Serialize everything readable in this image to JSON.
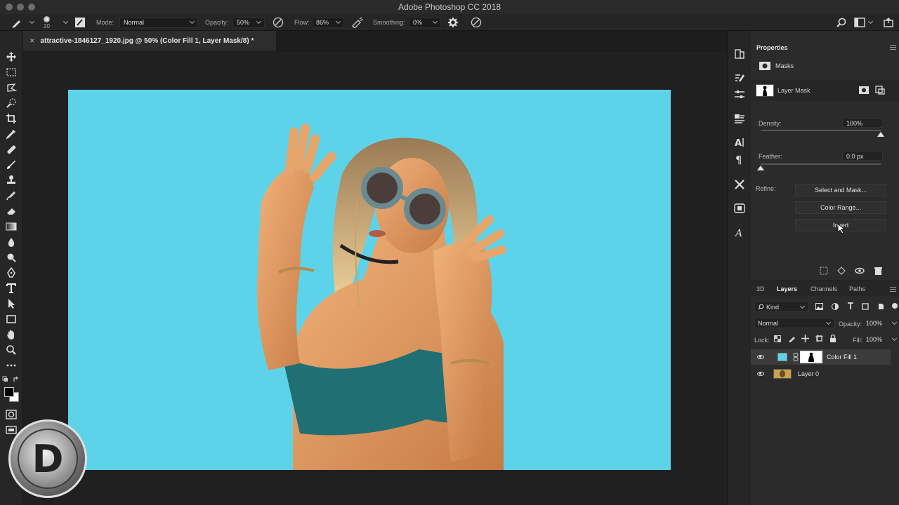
{
  "window": {
    "title": "Adobe Photoshop CC 2018"
  },
  "options_bar": {
    "brush_size": "20",
    "mode_label": "Mode:",
    "mode_value": "Normal",
    "opacity_label": "Opacity:",
    "opacity_value": "50%",
    "flow_label": "Flow:",
    "flow_value": "86%",
    "smoothing_label": "Smoothing:",
    "smoothing_value": "0%"
  },
  "document": {
    "tab_title": "attractive-1846127_1920.jpg @ 50% (Color Fill 1, Layer Mask/8) *"
  },
  "canvas": {
    "background_color": "#5dd3ea"
  },
  "properties": {
    "title": "Properties",
    "section": "Masks",
    "mask_type": "Layer Mask",
    "density_label": "Density:",
    "density_value": "100%",
    "density_fraction": 1.0,
    "feather_label": "Feather:",
    "feather_value": "0.0 px",
    "feather_fraction": 0.0,
    "refine_label": "Refine:",
    "buttons": [
      "Select and Mask...",
      "Color Range...",
      "Invert"
    ]
  },
  "layers_panel": {
    "tabs": [
      "3D",
      "Layers",
      "Channels",
      "Paths"
    ],
    "active_tab": "Layers",
    "filter_label": "Kind",
    "blend_mode": "Normal",
    "opacity_label": "Opacity:",
    "opacity_value": "100%",
    "lock_label": "Lock:",
    "fill_label": "Fill:",
    "fill_value": "100%",
    "layers": [
      {
        "name": "Color Fill 1",
        "swatch": "#5dd3ea",
        "selected": true
      },
      {
        "name": "Layer 0",
        "swatch": "#c9a24a",
        "selected": false
      }
    ]
  },
  "logo": {
    "letter": "D"
  }
}
